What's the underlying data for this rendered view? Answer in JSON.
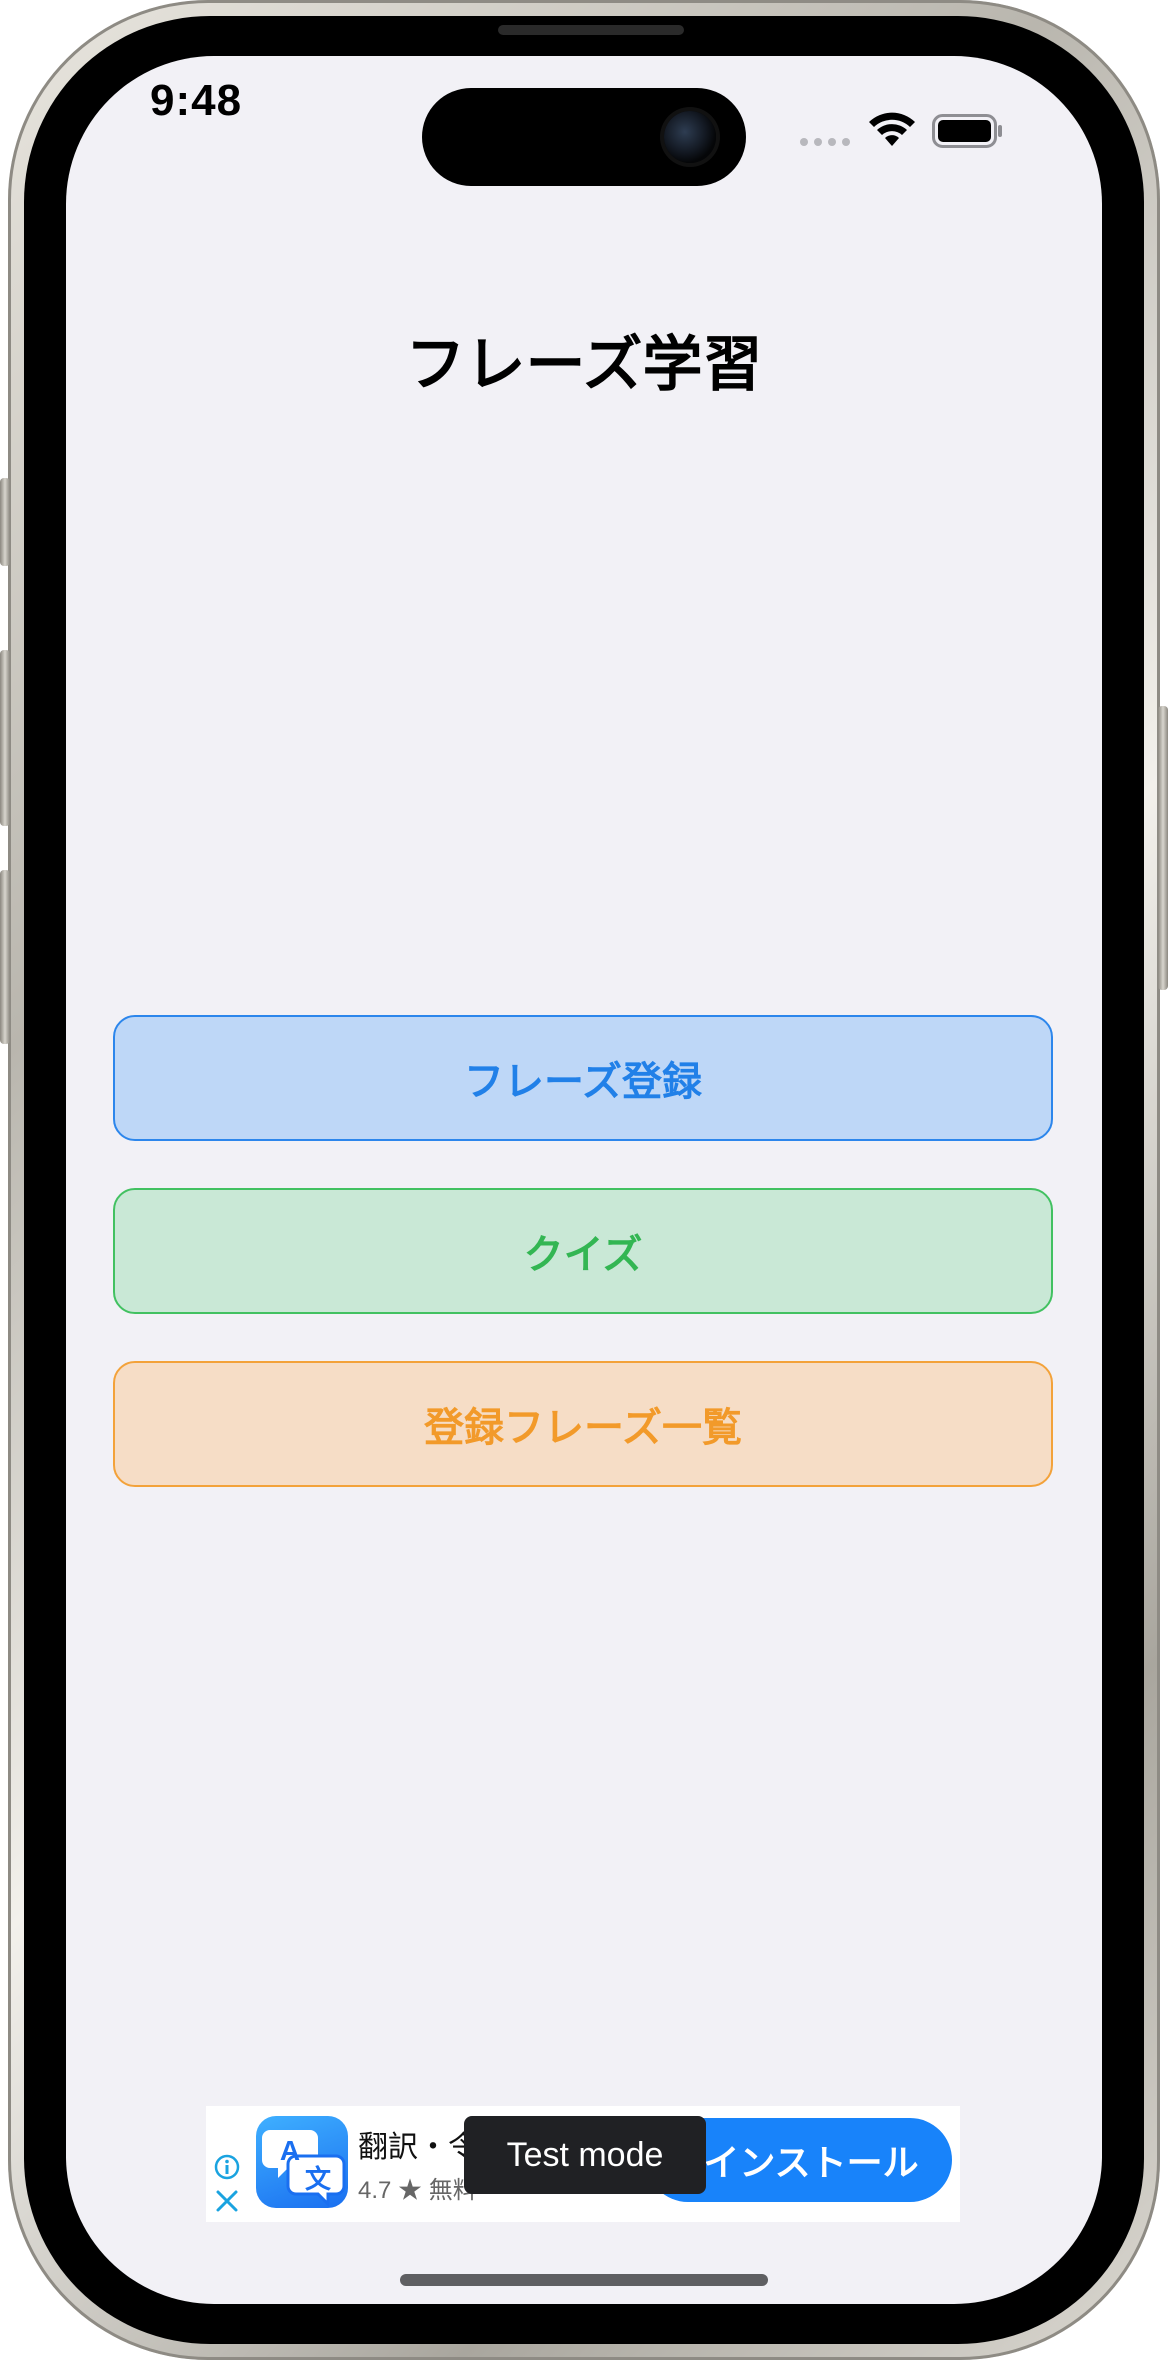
{
  "status_bar": {
    "time": "9:48",
    "icons": [
      "cellular-dots-icon",
      "wifi-icon",
      "battery-icon"
    ]
  },
  "header": {
    "title": "フレーズ学習"
  },
  "menu": {
    "buttons": [
      {
        "label": "フレーズ登録",
        "accent": "#2180e8",
        "background": "#bed7f7"
      },
      {
        "label": "クイズ",
        "accent": "#33b653",
        "background": "#c9e8d6"
      },
      {
        "label": "登録フレーズ一覧",
        "accent": "#f29a2a",
        "background": "#f6ddc6"
      }
    ]
  },
  "ad": {
    "app_name": "翻訳・令",
    "rating": "4.7",
    "price_partial": "無料",
    "install_label": "インストール",
    "test_mode_label": "Test mode",
    "icon_letters": {
      "top": "A",
      "bottom": "文"
    }
  },
  "colors": {
    "screen_background": "#f2f1f6",
    "install_button": "#1883fa",
    "ad_choices": "#1aa3e0"
  }
}
